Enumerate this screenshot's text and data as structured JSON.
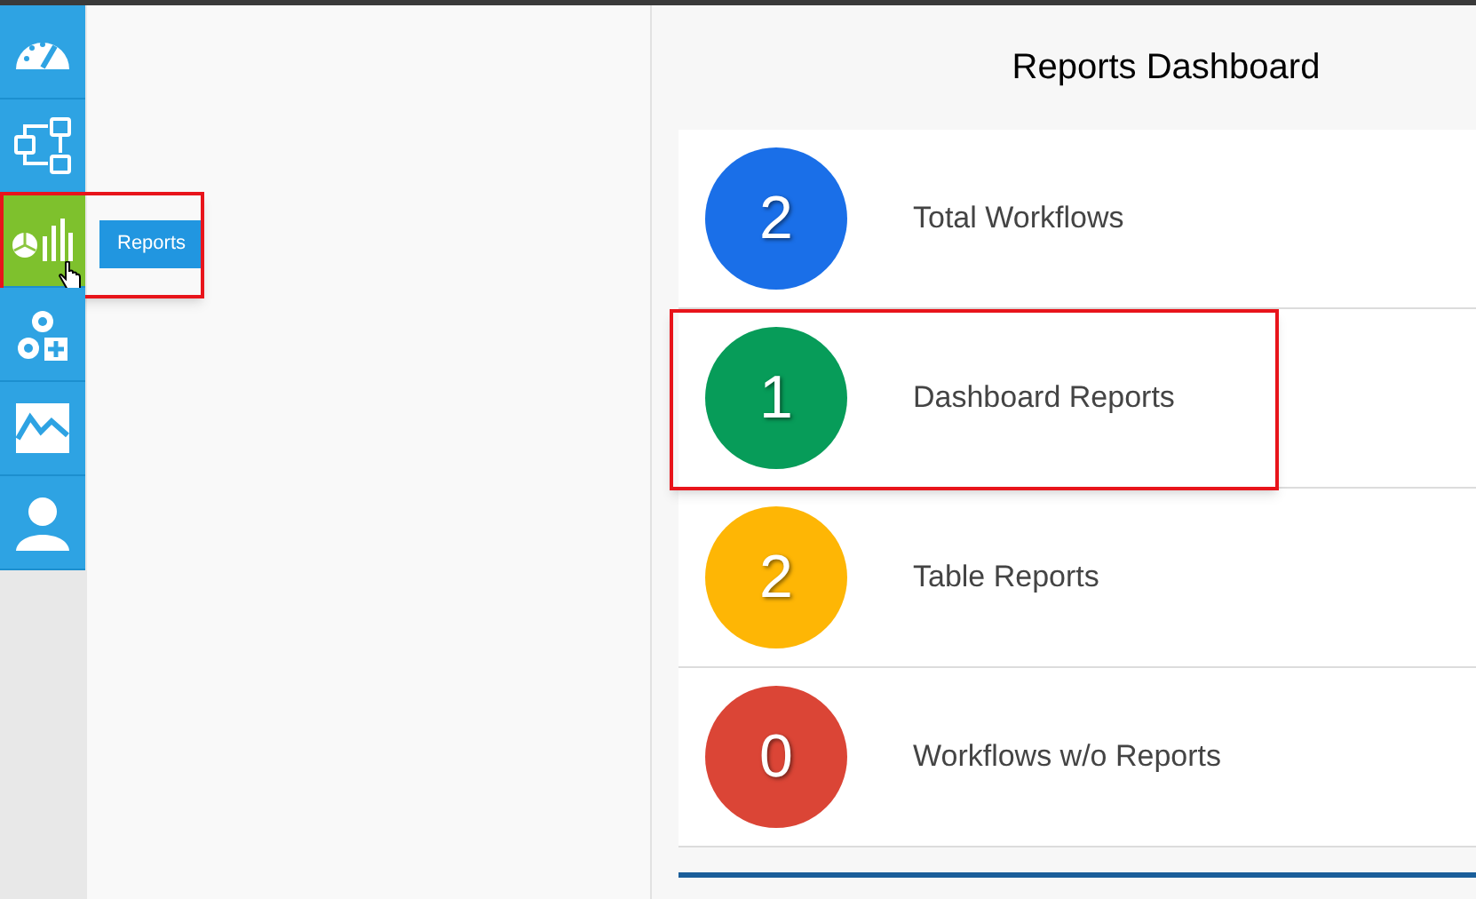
{
  "sidebar": {
    "items": [
      {
        "selected": false,
        "highlighted": false
      },
      {
        "selected": false,
        "highlighted": false
      },
      {
        "selected": true,
        "highlighted": true,
        "tooltip": "Reports"
      },
      {
        "selected": false,
        "highlighted": false
      },
      {
        "selected": false,
        "highlighted": false
      },
      {
        "selected": false,
        "highlighted": false
      }
    ]
  },
  "dashboard": {
    "title": "Reports Dashboard",
    "stats": [
      {
        "count": "2",
        "label": "Total Workflows",
        "color": "#1a6fe8",
        "highlighted": false
      },
      {
        "count": "1",
        "label": "Dashboard Reports",
        "color": "#079c59",
        "highlighted": true
      },
      {
        "count": "2",
        "label": "Table Reports",
        "color": "#feb605",
        "highlighted": false
      },
      {
        "count": "0",
        "label": "Workflows w/o Reports",
        "color": "#db4536",
        "highlighted": false
      }
    ]
  }
}
